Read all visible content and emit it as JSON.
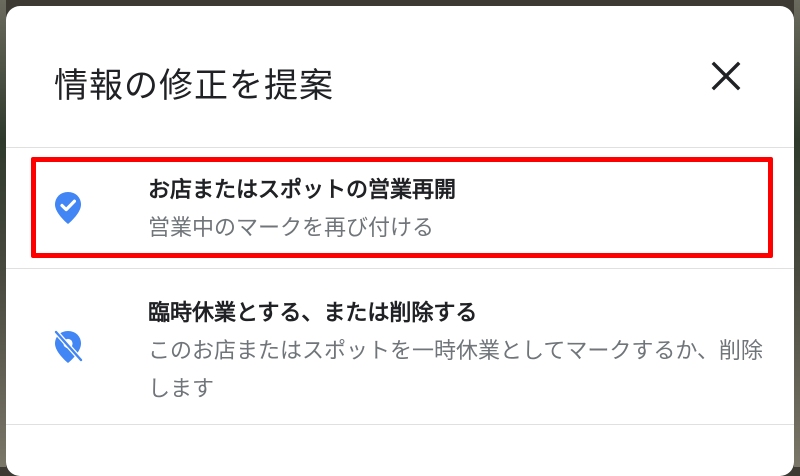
{
  "dialog": {
    "title": "情報の修正を提案",
    "close_icon": "close-icon"
  },
  "options": [
    {
      "icon": "place-check-icon",
      "title": "お店またはスポットの営業再開",
      "description": "営業中のマークを再び付ける"
    },
    {
      "icon": "place-off-icon",
      "title": "臨時休業とする、または削除する",
      "description": "このお店またはスポットを一時休業としてマークするか、削除します"
    }
  ],
  "colors": {
    "accent": "#4285f4",
    "highlight": "#ff0000",
    "title_text": "#202124",
    "secondary_text": "#70757a",
    "divider": "#e0e0e0"
  }
}
